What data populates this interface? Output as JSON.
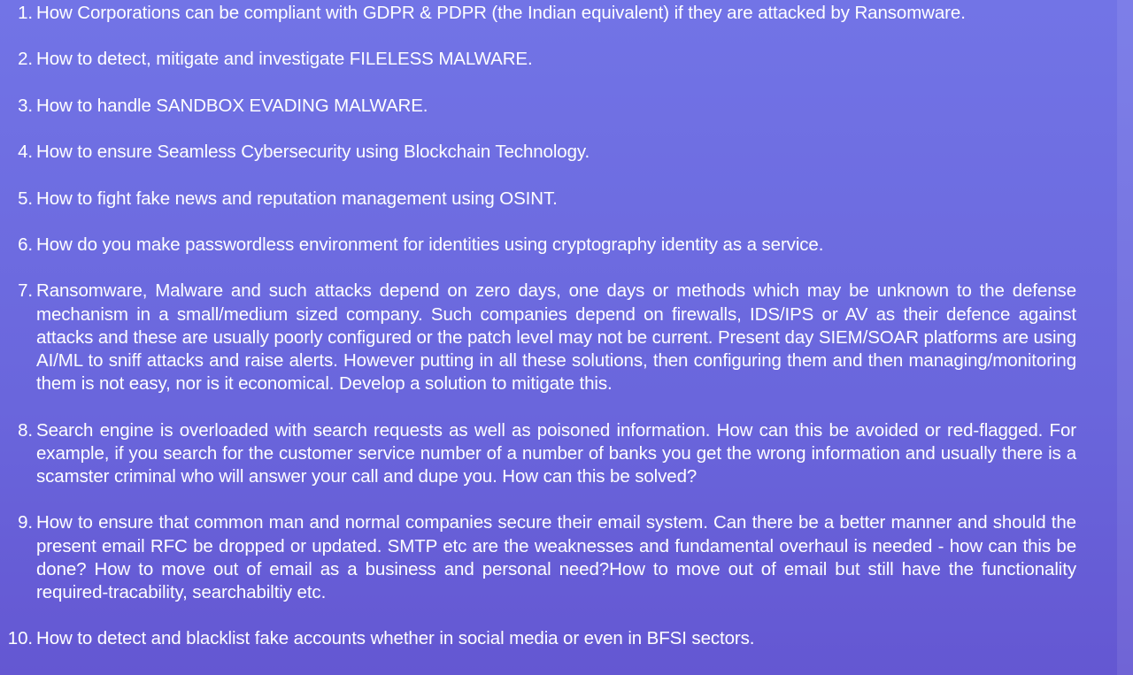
{
  "items": [
    {
      "number": "1.",
      "text": "How Corporations can be compliant with GDPR & PDPR (the Indian equivalent) if they are attacked by Ransomware."
    },
    {
      "number": "2.",
      "text": "How to detect, mitigate and investigate FILELESS MALWARE."
    },
    {
      "number": "3.",
      "text": "How to handle SANDBOX EVADING MALWARE."
    },
    {
      "number": "4.",
      "text": "How to ensure Seamless Cybersecurity using Blockchain Technology."
    },
    {
      "number": "5.",
      "text": "How to fight fake news and reputation management using OSINT."
    },
    {
      "number": "6.",
      "text": "How do you make passwordless environment for identities using cryptography identity as a service."
    },
    {
      "number": "7.",
      "text": "Ransomware, Malware and such attacks depend on zero days, one days or methods which may be unknown to the defense mechanism in a small/medium sized company. Such companies depend on firewalls, IDS/IPS or AV as their defence against attacks and these are usually poorly configured or the patch level may not be current. Present day SIEM/SOAR platforms are using AI/ML to sniff attacks and raise alerts. However putting in all these solutions, then configuring them and then managing/monitoring them is not easy, nor is it economical. Develop a solution to mitigate this."
    },
    {
      "number": "8.",
      "text": "Search engine is overloaded with search requests as well as poisoned information. How can this be avoided or red-flagged. For example, if you search for the customer service number of a number of banks you get the wrong information and usually there is a scamster criminal who will answer your call and dupe you. How can this be solved?"
    },
    {
      "number": "9.",
      "text": "How to ensure that common man and normal companies secure their email system. Can there be a better manner and should the present email RFC be dropped or updated. SMTP etc are the weaknesses and fundamental overhaul is needed - how can this be done? How to move out of email as a business and personal need?How to move out of email but still have the functionality required-tracability, searchabiltiy etc."
    },
    {
      "number": "10.",
      "text": "How to detect and blacklist fake accounts whether in social media or even in BFSI sectors."
    }
  ]
}
